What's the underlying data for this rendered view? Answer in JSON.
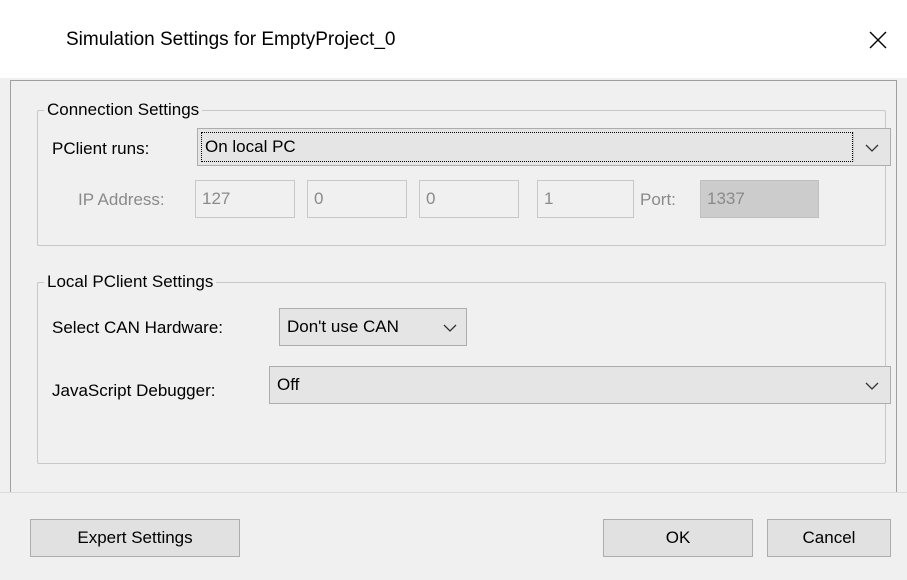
{
  "window": {
    "title": "Simulation Settings for EmptyProject_0",
    "close_glyph": "✕"
  },
  "connection": {
    "legend": "Connection Settings",
    "pclient_label": "PClient runs:",
    "pclient_value": "On local PC",
    "ip_label": "IP Address:",
    "ip": [
      "127",
      "0",
      "0",
      "1"
    ],
    "port_label": "Port:",
    "port_value": "1337"
  },
  "local": {
    "legend": "Local PClient Settings",
    "can_label": "Select CAN Hardware:",
    "can_value": "Don't use CAN",
    "js_label": "JavaScript Debugger:",
    "js_value": "Off"
  },
  "footer": {
    "expert_label": "Expert Settings",
    "ok_label": "OK",
    "cancel_label": "Cancel"
  }
}
